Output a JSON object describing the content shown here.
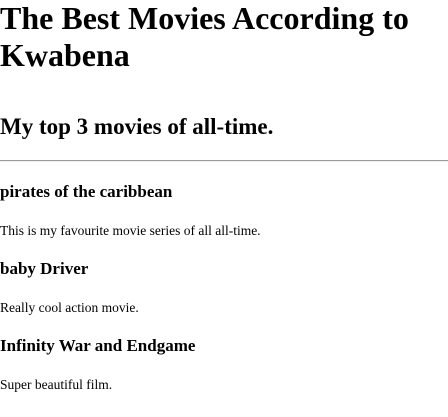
{
  "header": {
    "title": "The Best Movies According to Kwabena",
    "subtitle": "My top 3 movies of all-time."
  },
  "movies": [
    {
      "title": "pirates of the caribbean",
      "description": "This is my favourite movie series of all all-time."
    },
    {
      "title": "baby Driver",
      "description": "Really cool action movie."
    },
    {
      "title": "Infinity War and Endgame",
      "description": "Super beautiful film."
    }
  ]
}
